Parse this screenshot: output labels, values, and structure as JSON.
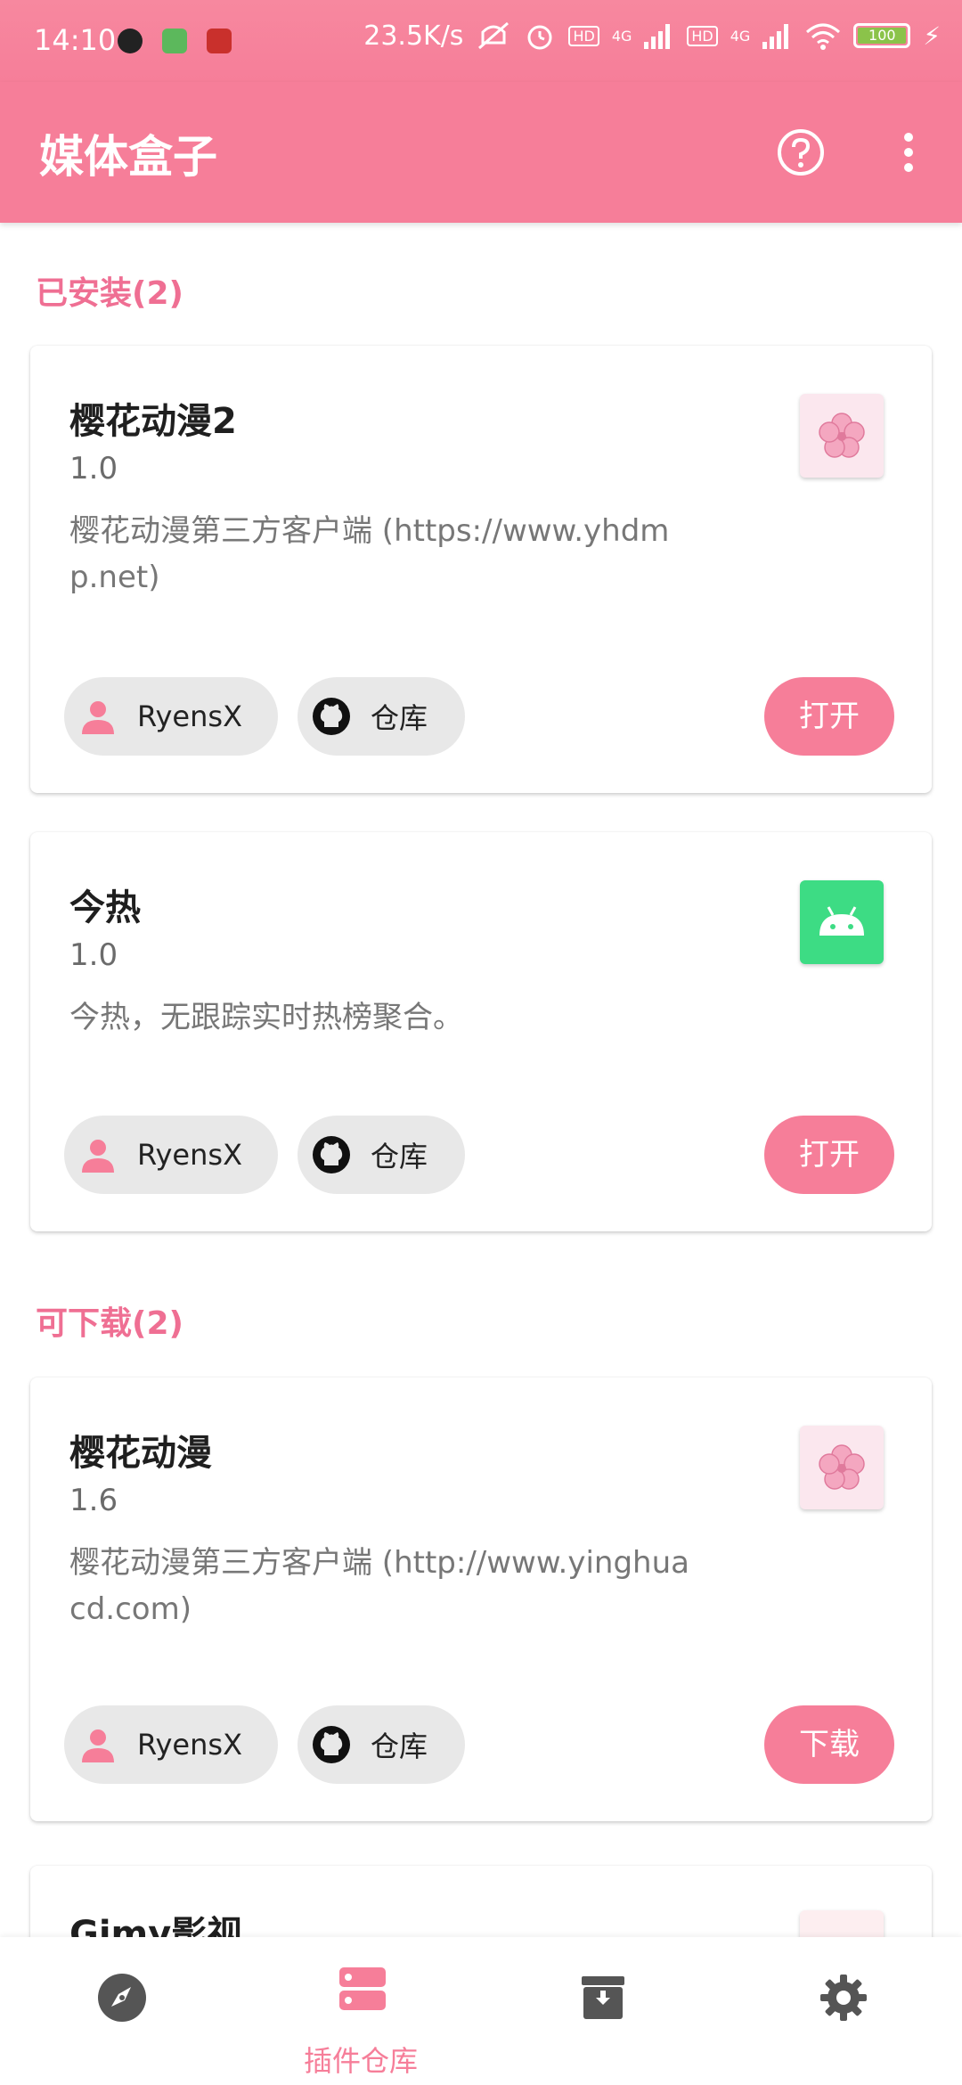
{
  "status": {
    "time": "14:10",
    "speed": "23.5K/s",
    "battery": "100",
    "net1": "4G",
    "net2": "4G",
    "hd1": "HD",
    "hd2": "HD"
  },
  "appbar": {
    "title": "媒体盒子",
    "help_icon": "help-circle-icon",
    "more_icon": "more-vert-icon"
  },
  "sections": {
    "installed": "已安装(2)",
    "available": "可下载(2)"
  },
  "plugins": [
    {
      "name": "樱花动漫2",
      "version": "1.0",
      "desc": "樱花动漫第三方客户端 (https://www.yhdmp.net)",
      "author": "RyensX",
      "repo": "仓库",
      "action": "打开",
      "icon": "sakura-icon"
    },
    {
      "name": "今热",
      "version": "1.0",
      "desc": "今热，无跟踪实时热榜聚合。",
      "author": "RyensX",
      "repo": "仓库",
      "action": "打开",
      "icon": "android-icon"
    },
    {
      "name": "樱花动漫",
      "version": "1.6",
      "desc": "樱花动漫第三方客户端 (http://www.yinghuacd.com)",
      "author": "RyensX",
      "repo": "仓库",
      "action": "下载",
      "icon": "sakura-icon"
    },
    {
      "name": "Gimy影视"
    }
  ],
  "nav": [
    {
      "icon": "compass-icon",
      "label": ""
    },
    {
      "icon": "storage-icon",
      "label": "插件仓库",
      "active": true
    },
    {
      "icon": "archive-icon",
      "label": ""
    },
    {
      "icon": "gear-icon",
      "label": ""
    }
  ],
  "colors": {
    "accent": "#f67e99",
    "section": "#ef6f93",
    "chip": "#e8e8e8"
  }
}
